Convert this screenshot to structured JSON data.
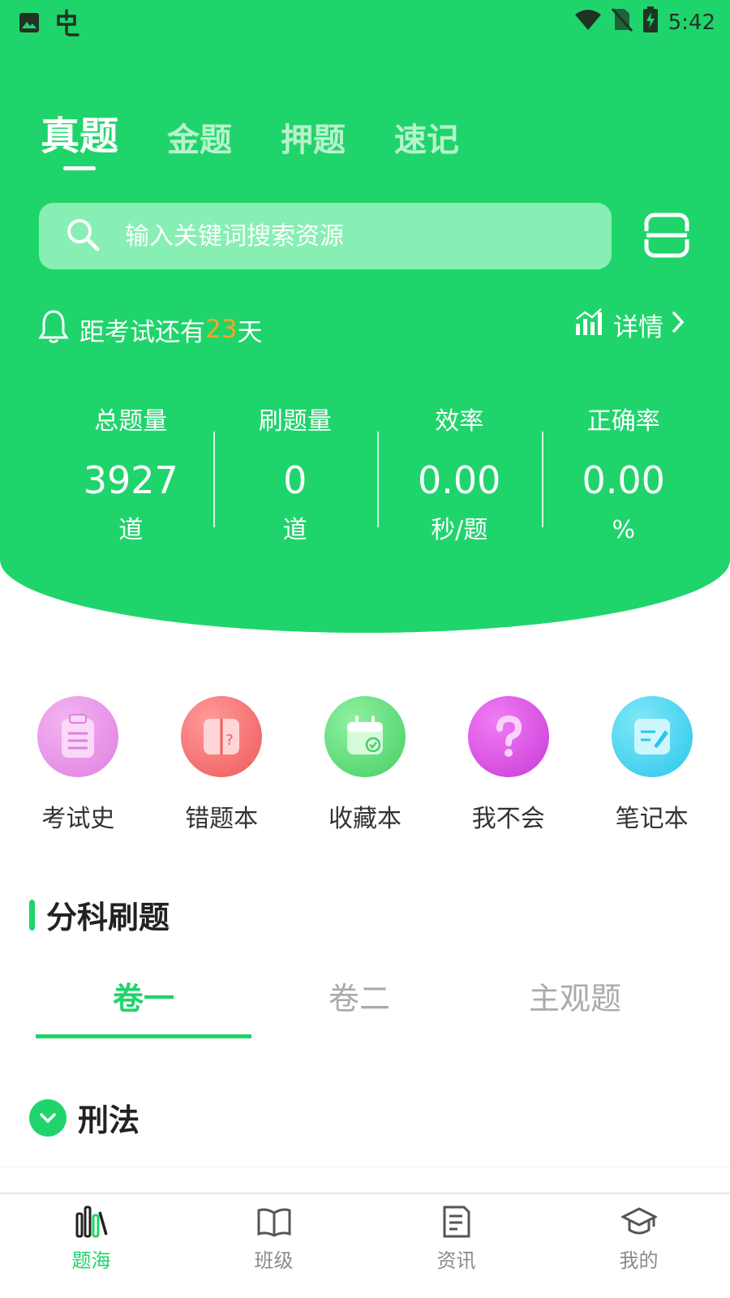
{
  "status_bar": {
    "time": "5:42",
    "left_icons": [
      "image-icon",
      "app-logo-icon"
    ],
    "right_icons": [
      "wifi-icon",
      "no-sim-icon",
      "battery-charging-icon"
    ]
  },
  "top_tabs": [
    {
      "label": "真题",
      "active": true
    },
    {
      "label": "金题",
      "active": false
    },
    {
      "label": "押题",
      "active": false
    },
    {
      "label": "速记",
      "active": false
    }
  ],
  "search": {
    "placeholder": "输入关键词搜索资源"
  },
  "countdown": {
    "prefix": "距考试还有",
    "days": "23",
    "suffix": "天"
  },
  "detail": {
    "label": "详情"
  },
  "stats": [
    {
      "label": "总题量",
      "value": "3927",
      "unit": "道"
    },
    {
      "label": "刷题量",
      "value": "0",
      "unit": "道"
    },
    {
      "label": "效率",
      "value": "0.00",
      "unit": "秒/题"
    },
    {
      "label": "正确率",
      "value": "0.00",
      "unit": "%"
    }
  ],
  "tools": [
    {
      "label": "考试史",
      "icon": "clipboard-icon",
      "color": "#e98ae8"
    },
    {
      "label": "错题本",
      "icon": "wrong-book-icon",
      "color": "#f26262"
    },
    {
      "label": "收藏本",
      "icon": "calendar-check-icon",
      "color": "#56d96f"
    },
    {
      "label": "我不会",
      "icon": "question-icon",
      "color": "#d94ce0"
    },
    {
      "label": "笔记本",
      "icon": "note-edit-icon",
      "color": "#2fd4ef"
    }
  ],
  "section": {
    "title": "分科刷题"
  },
  "sub_tabs": [
    {
      "label": "卷一",
      "active": true
    },
    {
      "label": "卷二",
      "active": false
    },
    {
      "label": "主观题",
      "active": false
    }
  ],
  "subject": {
    "label": "刑法"
  },
  "bottom_nav": [
    {
      "label": "题海",
      "icon": "books-icon",
      "active": true
    },
    {
      "label": "班级",
      "icon": "open-book-icon",
      "active": false
    },
    {
      "label": "资讯",
      "icon": "document-icon",
      "active": false
    },
    {
      "label": "我的",
      "icon": "graduation-cap-icon",
      "active": false
    }
  ],
  "colors": {
    "accent": "#20d46c",
    "highlight": "#f5a623"
  }
}
